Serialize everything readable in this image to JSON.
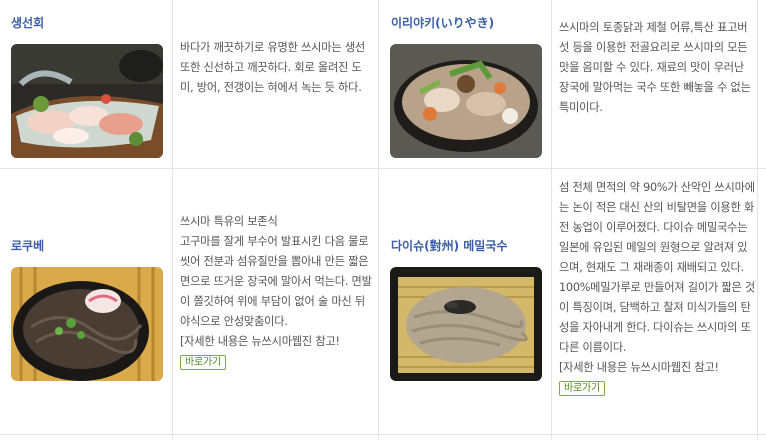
{
  "items": [
    {
      "title": "생선회",
      "image_alt": "boat-shaped platter of sliced raw fish sashimi",
      "description": "바다가 깨끗하기로 유명한 쓰시마는 생선 또한 신선하고 깨끗하다. 회로 올려진 도미, 방어, 전갱이는 혀에서 녹는 듯 하다."
    },
    {
      "title": "이리야키(いりやき)",
      "image_alt": "hot pot with chicken, fish, mushrooms and vegetables",
      "description": "쓰시마의 토종닭과 제철 어류,특산 표고버섯 등을 이용한 전골요리로 쓰시마의 모든 맛을 음미할 수 있다. 재료의 맛이 우러난 장국에 말아먹는 국수 또한 빼놓을 수 없는 특미이다."
    },
    {
      "title": "로쿠베",
      "image_alt": "dark noodles in broth with fish cake and green onion",
      "description_lines": [
        "쓰시마 특유의 보존식",
        "고구마를 잘게 부수어 발표시킨 다음 물로 씻어 전분과 섬유질만을 뽑아내 만든 짧은 면으로 뜨거운 장국에 말아서 먹는다. 면발이 쫄깃하여 위에 부담이 없어 술 마신 뒤 야식으로 안성맞춤이다."
      ],
      "reference": "[자세한 내용은 뉴쓰시마웹진 참고!",
      "button": "바로가기"
    },
    {
      "title": "다이슈(對州) 메밀국수",
      "image_alt": "buckwheat soba noodles with seaweed on bamboo tray",
      "description": "섬 전체 면적의 약 90%가 산악인 쓰시마에는 논이 적은 대신 산의 비탈면을 이용한 화전 농업이 이루어졌다. 다이슈 메밀국수는 일본에 유입된 메일의 원형으로 알려져 있으며, 현재도 그 재래종이 재배되고 있다. 100%메밀가루로 만들어져 길이가 짧은 것이 특징이며, 담백하고 찰져 미식가들의 탄성을 자아내게 한다. 다이슈는 쓰시마의 또 다른 이름이다.",
      "reference": "[자세한 내용은 뉴쓰시마웹진 참고!",
      "button": "바로가기"
    }
  ],
  "colors": {
    "title": "#3b5ea6",
    "border": "#e3e3e3",
    "button_border": "#7caa4c",
    "button_text": "#4f8a1e"
  }
}
